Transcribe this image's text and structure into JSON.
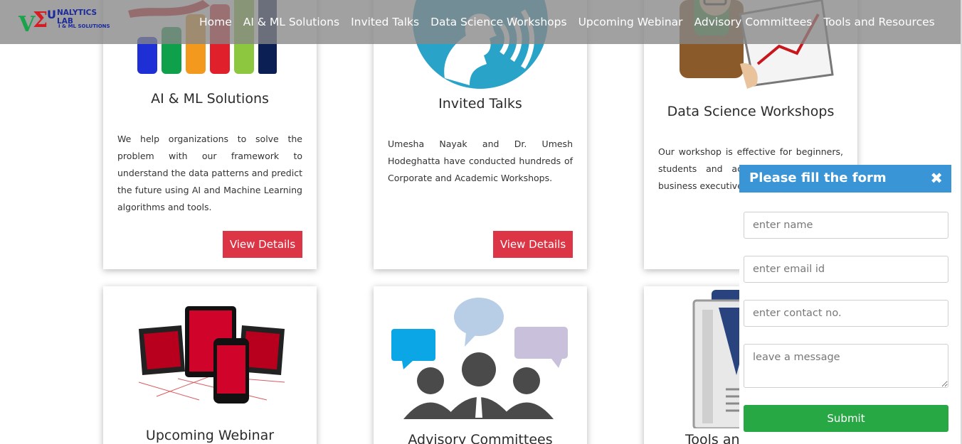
{
  "brand": {
    "logo_name": "NALYTICS LAB",
    "logo_sub": "I & ML SOLUTIONS"
  },
  "nav": {
    "items": [
      "Home",
      "AI & ML Solutions",
      "Invited Talks",
      "Data Science Workshops",
      "Upcoming Webinar",
      "Advisory Committees",
      "Tools and Resources"
    ]
  },
  "cards": [
    {
      "title": "AI & ML Solutions",
      "text": "We help organizations to solve the problem with our framework to understand the data patterns and predict the future using AI and Machine Learning algorithms and tools.",
      "button": "View Details",
      "icon": "bar-chart-icon"
    },
    {
      "title": "Invited Talks",
      "text": "Umesha Nayak and Dr. Umesh Hodeghatta have conducted hundreds of Corporate and Academic Workshops.",
      "button": "View Details",
      "icon": "speaking-head-icon"
    },
    {
      "title": "Data Science Workshops",
      "text": "Our workshop is effective for beginners, students and ac practitioners as w business executives.",
      "icon": "presenter-chart-icon"
    },
    {
      "title": "Upcoming Webinar",
      "icon": "devices-icon"
    },
    {
      "title": "Advisory Committees",
      "icon": "people-chat-icon"
    },
    {
      "title": "Tools an",
      "icon": "book-icon"
    }
  ],
  "form": {
    "title": "Please fill the form",
    "close_symbol": "✖",
    "name_placeholder": "enter name",
    "email_placeholder": "enter email id",
    "contact_placeholder": "enter contact no.",
    "message_placeholder": "leave a message",
    "submit": "Submit"
  },
  "colors": {
    "view_button": "#dc3545",
    "form_header": "#3a95d6",
    "submit_button": "#28a745",
    "navbar": "rgba(135,135,135,0.78)"
  }
}
